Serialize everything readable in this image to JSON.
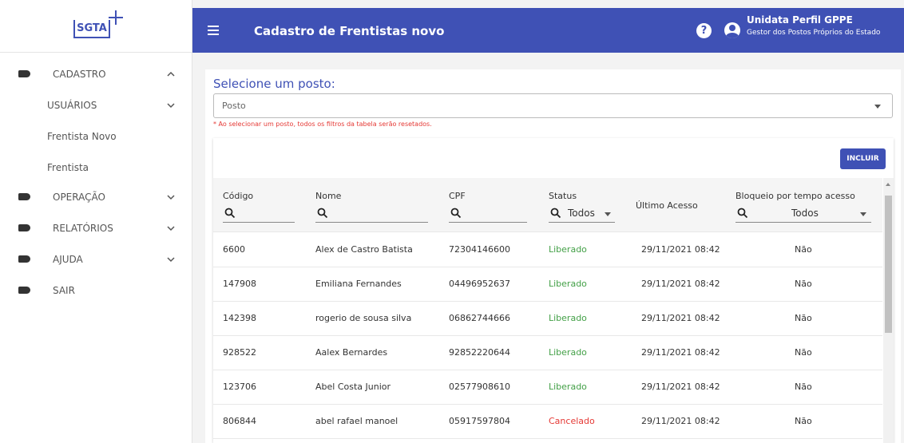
{
  "sidebar": {
    "logo": "SGTA",
    "items": [
      {
        "label": "CADASTRO",
        "icon": "tag-icon",
        "chevron": "up"
      },
      {
        "label": "USUÁRIOS",
        "chevron": "down"
      },
      {
        "label": "Frentista Novo"
      },
      {
        "label": "Frentista"
      },
      {
        "label": "OPERAÇÃO",
        "icon": "tag-icon",
        "chevron": "down"
      },
      {
        "label": "RELATÓRIOS",
        "icon": "tag-icon",
        "chevron": "down"
      },
      {
        "label": "AJUDA",
        "icon": "tag-icon",
        "chevron": "down"
      },
      {
        "label": "SAIR",
        "icon": "tag-icon"
      }
    ]
  },
  "header": {
    "title": "Cadastro de Frentistas novo",
    "user_name": "Unidata Perfil GPPE",
    "user_role": "Gestor dos Postos Próprios do Estado",
    "help": "?"
  },
  "main": {
    "section_title": "Selecione um posto:",
    "posto_placeholder": "Posto",
    "warning": "* Ao selecionar um posto, todos os filtros da tabela serão resetados.",
    "incluir_label": "INCLUIR"
  },
  "table": {
    "columns": [
      "Código",
      "Nome",
      "CPF",
      "Status",
      "Último Acesso",
      "Bloqueio por tempo acesso"
    ],
    "status_filter": "Todos",
    "bloqueio_filter": "Todos",
    "rows": [
      {
        "codigo": "6600",
        "nome": "Alex de Castro Batista",
        "cpf": "72304146600",
        "status": "Liberado",
        "acesso": "29/11/2021 08:42",
        "bloqueio": "Não"
      },
      {
        "codigo": "147908",
        "nome": "Emiliana Fernandes",
        "cpf": "04496952637",
        "status": "Liberado",
        "acesso": "29/11/2021 08:42",
        "bloqueio": "Não"
      },
      {
        "codigo": "142398",
        "nome": "rogerio de sousa silva",
        "cpf": "06862744666",
        "status": "Liberado",
        "acesso": "29/11/2021 08:42",
        "bloqueio": "Não"
      },
      {
        "codigo": "928522",
        "nome": "Aalex Bernardes",
        "cpf": "92852220644",
        "status": "Liberado",
        "acesso": "29/11/2021 08:42",
        "bloqueio": "Não"
      },
      {
        "codigo": "123706",
        "nome": "Abel Costa Junior",
        "cpf": "02577908610",
        "status": "Liberado",
        "acesso": "29/11/2021 08:42",
        "bloqueio": "Não"
      },
      {
        "codigo": "806844",
        "nome": "abel rafael manoel",
        "cpf": "05917597804",
        "status": "Cancelado",
        "acesso": "29/11/2021 08:42",
        "bloqueio": "Não"
      }
    ]
  },
  "colors": {
    "primary": "#3f51b5",
    "liberado": "#43a047",
    "cancelado": "#e53935"
  }
}
